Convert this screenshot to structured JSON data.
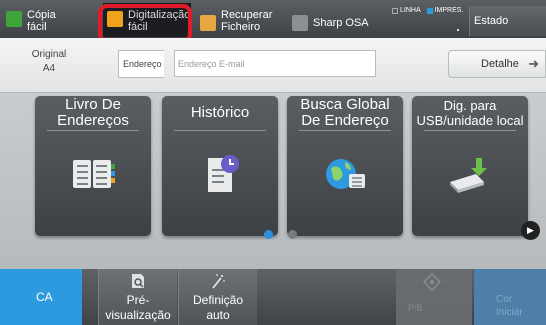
{
  "top_tabs": [
    {
      "label": "Cópia\nfácil",
      "icon": "copy-icon"
    },
    {
      "label": "Digitalização\nfácil",
      "icon": "scan-icon",
      "selected": true
    },
    {
      "label": "Recuperar\nFicheiro",
      "icon": "folder-icon"
    },
    {
      "label": "Sharp OSA",
      "icon": "sharp-osa-icon"
    }
  ],
  "indicators": {
    "line": "LINHA",
    "print": "IMPRES."
  },
  "job_status": "Estado trabalho",
  "original": {
    "label": "Original",
    "size": "A4"
  },
  "address": {
    "label": "Endereço",
    "placeholder": "Endereço E-mail"
  },
  "detail_button": "Detalhe",
  "tiles": [
    {
      "label": "Livro De\nEndereços",
      "icon": "address-book-icon"
    },
    {
      "label": "Histórico",
      "icon": "history-icon"
    },
    {
      "label": "Busca Global\nDe Endereço",
      "icon": "global-address-icon"
    },
    {
      "label": "Dig. para\nUSB/unidade local",
      "icon": "usb-icon"
    }
  ],
  "bottom": {
    "ca": "CA",
    "preview": "Pré-\nvisualização",
    "auto_setting": "Definição\nauto",
    "bw_start": "P/B",
    "color_start": "Cor\nIniciar"
  },
  "colors": {
    "accent": "#2d99de",
    "highlight_ring": "#e11a2b"
  }
}
